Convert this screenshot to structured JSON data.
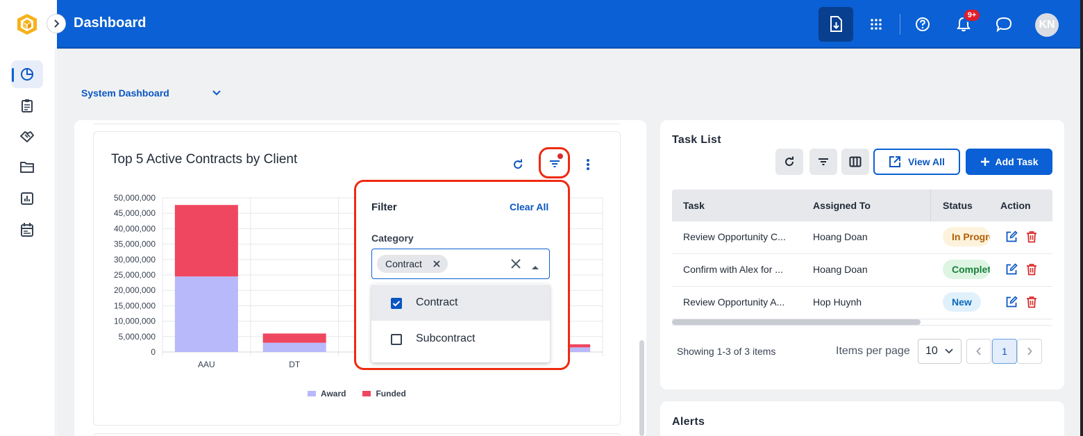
{
  "header": {
    "title": "Dashboard",
    "notification_badge": "9+",
    "avatar_initials": "KN",
    "accent_color": "#0a60d4"
  },
  "sidebar": {
    "items": [
      {
        "icon": "pie-chart-icon",
        "active": true
      },
      {
        "icon": "clipboard-icon",
        "active": false
      },
      {
        "icon": "handshake-icon",
        "active": false
      },
      {
        "icon": "folder-icon",
        "active": false
      },
      {
        "icon": "bar-report-icon",
        "active": false
      },
      {
        "icon": "calendar-icon",
        "active": false
      }
    ]
  },
  "dashboard_selector": {
    "value": "System Dashboard"
  },
  "contracts_card": {
    "title": "Top 5 Active Contracts by Client"
  },
  "chart_data": {
    "type": "bar",
    "stacked": true,
    "categories": [
      "AAU",
      "DT",
      "",
      "",
      ""
    ],
    "yticks": [
      "50,000,000",
      "45,000,000",
      "40,000,000",
      "35,000,000",
      "30,000,000",
      "25,000,000",
      "20,000,000",
      "15,000,000",
      "10,000,000",
      "5,000,000",
      "0"
    ],
    "ylim": [
      0,
      50000000
    ],
    "series": [
      {
        "name": "Award",
        "color": "#b8b9fb",
        "values": [
          24500000,
          3000000,
          null,
          null,
          1500000
        ]
      },
      {
        "name": "Funded",
        "color": "#ef4760",
        "values": [
          23200000,
          3000000,
          null,
          null,
          1000000
        ]
      }
    ],
    "legend_position": "bottom",
    "grid": true
  },
  "filter_popup": {
    "title": "Filter",
    "clear_all": "Clear All",
    "category_label": "Category",
    "selected_chip": "Contract",
    "options": [
      {
        "label": "Contract",
        "checked": true
      },
      {
        "label": "Subcontract",
        "checked": false
      }
    ]
  },
  "task_list": {
    "title": "Task List",
    "view_all": "View All",
    "add_task": "Add Task",
    "columns": [
      "Task",
      "Assigned To",
      "Status",
      "Action"
    ],
    "rows": [
      {
        "task": "Review Opportunity C...",
        "assigned": "Hoang Doan",
        "status": "In Progress"
      },
      {
        "task": "Confirm with Alex for ...",
        "assigned": "Hoang Doan",
        "status": "Completed"
      },
      {
        "task": "Review Opportunity A...",
        "assigned": "Hop Huynh",
        "status": "New"
      }
    ],
    "showing": "Showing 1-3 of 3 items",
    "items_per_page_label": "Items per page",
    "items_per_page": "10",
    "current_page": "1"
  },
  "alerts": {
    "title": "Alerts"
  }
}
